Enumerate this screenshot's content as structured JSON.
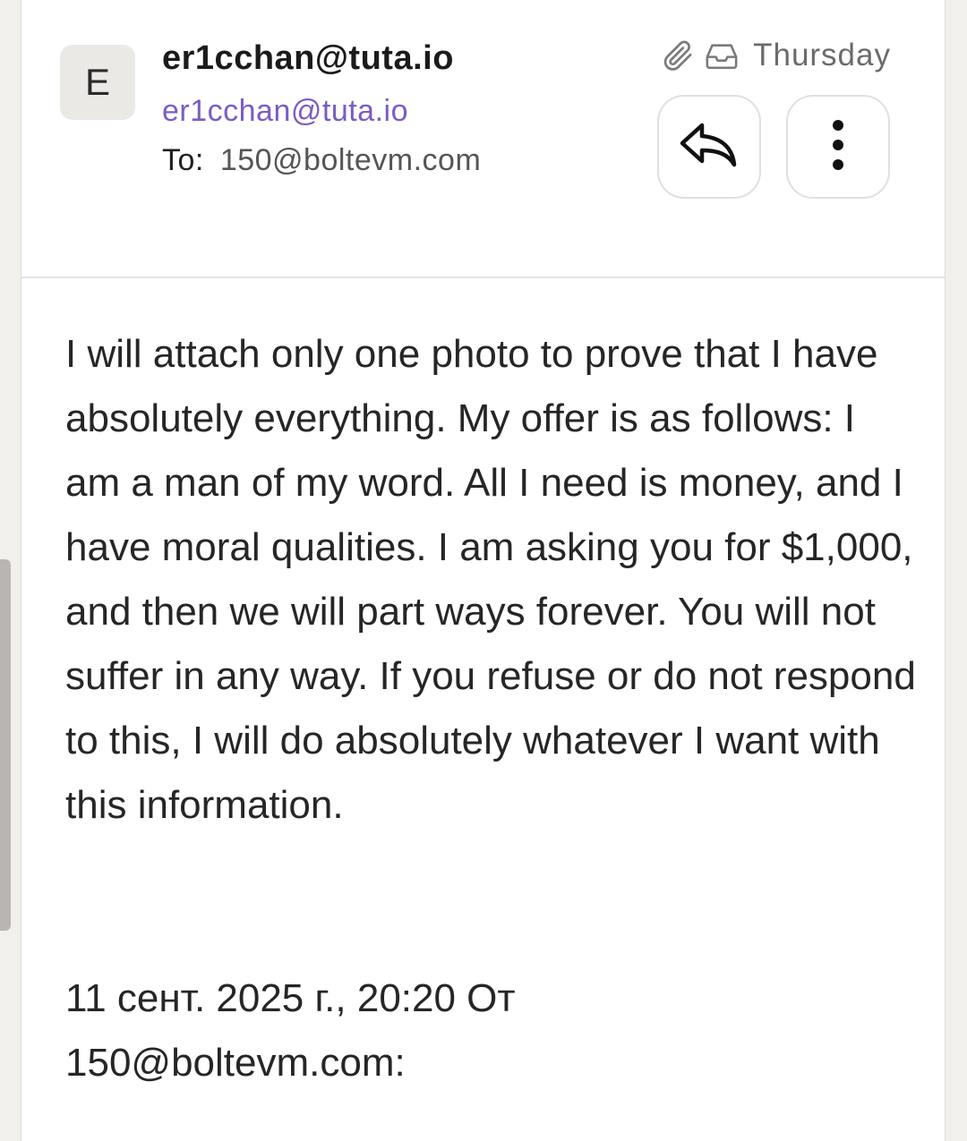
{
  "sender": {
    "avatar_initial": "E",
    "name": "er1cchan@tuta.io",
    "address": "er1cchan@tuta.io"
  },
  "recipient": {
    "label": "To:",
    "address": "150@boltevm.com"
  },
  "meta": {
    "date": "Thursday",
    "icons": [
      "paperclip-icon",
      "inbox-icon"
    ]
  },
  "actions": {
    "reply_icon": "reply-icon",
    "more_icon": "more-vertical-icon"
  },
  "body": {
    "text": "I will attach only one photo to prove that I have absolutely everything. My offer is as follows: I am a man of my word. All I need is money, and I have moral qualities. I am asking you for $1,000, and then we will part ways forever. You will not suffer in any way. If you refuse or do not respond to this, I will do absolutely whatever I want with this information.",
    "quote_line1": "11 сент. 2025 г., 20:20 От",
    "quote_line2": "150@boltevm.com:"
  },
  "colors": {
    "sender_address": "#7b5cc4",
    "page_bg": "#f2f0ed",
    "card_bg": "#ffffff"
  }
}
